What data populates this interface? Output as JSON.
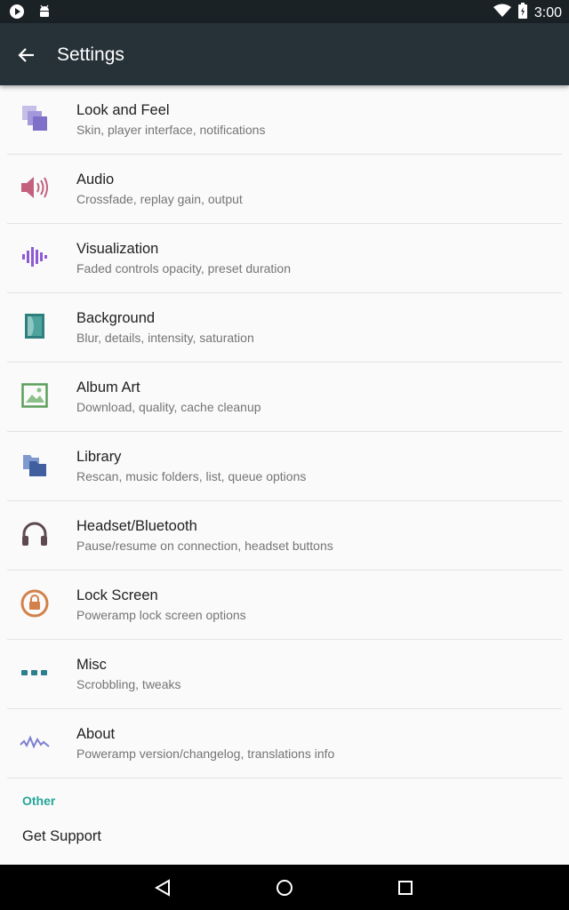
{
  "status_bar": {
    "time": "3:00",
    "left_icons": [
      "play-notification-icon",
      "android-icon"
    ],
    "right_icons": [
      "wifi-icon",
      "battery-icon"
    ]
  },
  "app_bar": {
    "title": "Settings",
    "background": "#263238"
  },
  "items": [
    {
      "title": "Look and Feel",
      "subtitle": "Skin, player interface, notifications",
      "icon": "look-and-feel-icon",
      "color": "#7e6fc8"
    },
    {
      "title": "Audio",
      "subtitle": "Crossfade, replay gain, output",
      "icon": "speaker-icon",
      "color": "#c2607e"
    },
    {
      "title": "Visualization",
      "subtitle": "Faded controls opacity, preset duration",
      "icon": "waveform-icon",
      "color": "#8e5ad6"
    },
    {
      "title": "Background",
      "subtitle": "Blur, details, intensity, saturation",
      "icon": "background-icon",
      "color": "#2f7f7e"
    },
    {
      "title": "Album Art",
      "subtitle": "Download, quality, cache cleanup",
      "icon": "image-icon",
      "color": "#5c9e5b"
    },
    {
      "title": "Library",
      "subtitle": "Rescan, music folders, list, queue options",
      "icon": "folders-icon",
      "color": "#3f5f9f"
    },
    {
      "title": "Headset/Bluetooth",
      "subtitle": "Pause/resume on connection, headset buttons",
      "icon": "headphones-icon",
      "color": "#5d4a4f"
    },
    {
      "title": "Lock Screen",
      "subtitle": "Poweramp lock screen options",
      "icon": "lock-icon",
      "color": "#d3814a"
    },
    {
      "title": "Misc",
      "subtitle": "Scrobbling, tweaks",
      "icon": "dots-icon",
      "color": "#2b7f8f"
    },
    {
      "title": "About",
      "subtitle": "Poweramp version/changelog, translations info",
      "icon": "about-wave-icon",
      "color": "#7c7fd0"
    }
  ],
  "section_other": {
    "label": "Other",
    "color": "#26a69a"
  },
  "get_support": "Get Support",
  "nav_bar": [
    "back-icon",
    "home-icon",
    "recents-icon"
  ]
}
